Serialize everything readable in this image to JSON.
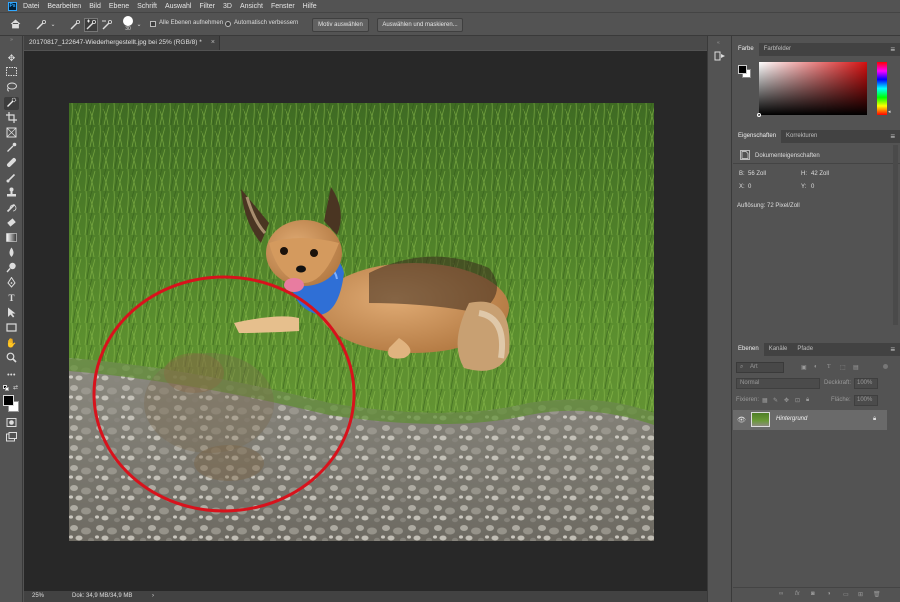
{
  "app": {
    "logo": "Ps"
  },
  "menu": [
    "Datei",
    "Bearbeiten",
    "Bild",
    "Ebene",
    "Schrift",
    "Auswahl",
    "Filter",
    "3D",
    "Ansicht",
    "Fenster",
    "Hilfe"
  ],
  "options": {
    "brush_size": "30",
    "sample_all_layers_label": "Alle Ebenen aufnehmen",
    "auto_enhance_label": "Automatisch verbessern",
    "select_subject_label": "Motiv auswählen",
    "select_and_mask_label": "Auswählen und maskieren..."
  },
  "document": {
    "tab_title": "20170817_122647-Wiederhergestellt.jpg bei 25% (RGB/8) *",
    "close_glyph": "×",
    "zoom": "25%",
    "doc_info": "Dok: 34,9 MB/34,9 MB",
    "status_arrow": "›"
  },
  "color_panel": {
    "tabs": [
      "Farbe",
      "Farbfelder"
    ],
    "hue_color": "#d41010"
  },
  "properties_panel": {
    "tabs": [
      "Eigenschaften",
      "Korrekturen"
    ],
    "section_title": "Dokumenteigenschaften",
    "width_label": "B:",
    "width_value": "56 Zoll",
    "height_label": "H:",
    "height_value": "42 Zoll",
    "x_label": "X:",
    "x_value": "0",
    "y_label": "Y:",
    "y_value": "0",
    "resolution": "Auflösung: 72 Pixel/Zoll"
  },
  "layers_panel": {
    "tabs": [
      "Ebenen",
      "Kanäle",
      "Pfade"
    ],
    "filter_placeholder": "Art",
    "blend_mode": "Normal",
    "opacity_label": "Deckkraft:",
    "opacity_value": "100%",
    "lock_label": "Fixieren:",
    "fill_label": "Fläche:",
    "fill_value": "100%",
    "layers": [
      {
        "name": "Hintergrund",
        "visible": true,
        "locked": true
      }
    ]
  },
  "annotation": {
    "circle_color": "#d8121c"
  },
  "colors": {
    "foreground": "#000000",
    "background": "#ffffff",
    "accent": "#31a8ff"
  }
}
